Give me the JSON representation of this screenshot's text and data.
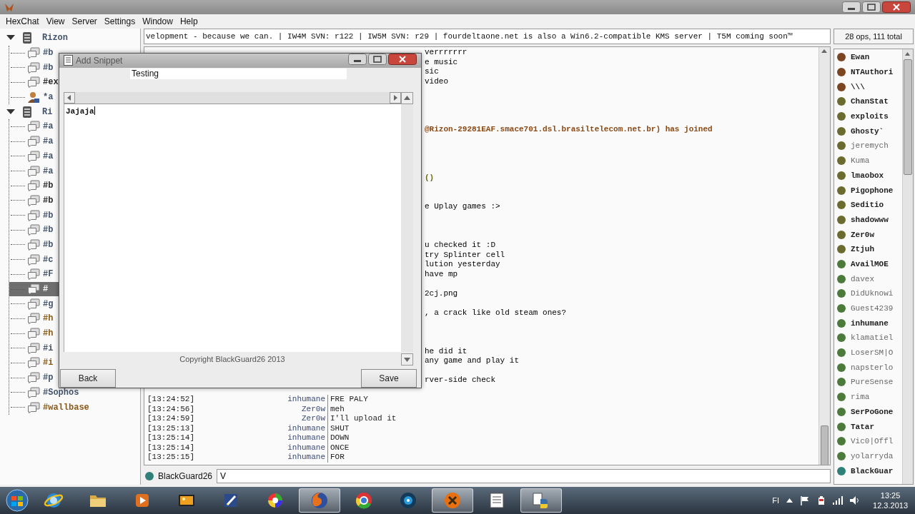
{
  "menu": [
    "HexChat",
    "View",
    "Server",
    "Settings",
    "Window",
    "Help"
  ],
  "tree": [
    {
      "label": "Rizon",
      "kind": "network",
      "expanded": true,
      "selected": false,
      "color": "#44546a",
      "children": [
        {
          "label": "#b",
          "kind": "channel",
          "selected": false,
          "color": "#44546a"
        },
        {
          "label": "#b",
          "kind": "channel",
          "selected": false,
          "color": "#44546a"
        },
        {
          "label": "#ex",
          "kind": "channel",
          "selected": false,
          "color": "#2b2b2b"
        },
        {
          "label": "*a",
          "kind": "query",
          "selected": false,
          "color": "#44546a"
        }
      ]
    },
    {
      "label": "Ri",
      "kind": "network",
      "expanded": true,
      "selected": false,
      "color": "#44546a",
      "children": [
        {
          "label": "#a",
          "kind": "channel",
          "selected": false,
          "color": "#44546a"
        },
        {
          "label": "#a",
          "kind": "channel",
          "selected": false,
          "color": "#44546a"
        },
        {
          "label": "#a",
          "kind": "channel",
          "selected": false,
          "color": "#44546a"
        },
        {
          "label": "#a",
          "kind": "channel",
          "selected": false,
          "color": "#44546a"
        },
        {
          "label": "#b",
          "kind": "channel",
          "selected": false,
          "color": "#2b2b2b"
        },
        {
          "label": "#b",
          "kind": "channel",
          "selected": false,
          "color": "#2b2b2b"
        },
        {
          "label": "#b",
          "kind": "channel",
          "selected": false,
          "color": "#44546a"
        },
        {
          "label": "#b",
          "kind": "channel",
          "selected": false,
          "color": "#44546a"
        },
        {
          "label": "#b",
          "kind": "channel",
          "selected": false,
          "color": "#44546a"
        },
        {
          "label": "#c",
          "kind": "channel",
          "selected": false,
          "color": "#44546a"
        },
        {
          "label": "#F",
          "kind": "channel",
          "selected": false,
          "color": "#44546a"
        },
        {
          "label": "#",
          "kind": "channel",
          "selected": true
        },
        {
          "label": "#g",
          "kind": "channel",
          "selected": false,
          "color": "#44546a"
        },
        {
          "label": "#h",
          "kind": "channel",
          "selected": false,
          "color": "#8a5a1a"
        },
        {
          "label": "#h",
          "kind": "channel",
          "selected": false,
          "color": "#8a5a1a"
        },
        {
          "label": "#i",
          "kind": "channel",
          "selected": false,
          "color": "#44546a"
        },
        {
          "label": "#i",
          "kind": "channel",
          "selected": false,
          "color": "#8a5a1a"
        },
        {
          "label": "#p",
          "kind": "channel",
          "selected": false,
          "color": "#44546a"
        },
        {
          "label": "#Sophos",
          "kind": "channel",
          "selected": false,
          "color": "#44546a"
        },
        {
          "label": "#wallbase",
          "kind": "channel",
          "selected": false,
          "color": "#8a5a1a"
        }
      ]
    }
  ],
  "topic": "velopment - because we can. | IW4M SVN: r122 | IW5M SVN: r29 | fourdeltaone.net is also a Win6.2-compatible KMS server | T5M coming soon™",
  "user_count": "28 ops, 111 total",
  "chat_lines": [
    {
      "kind": "fragment",
      "text": "verrrrrrr"
    },
    {
      "kind": "fragment",
      "text": "e music"
    },
    {
      "kind": "fragment",
      "text": "sic"
    },
    {
      "kind": "fragment",
      "text": "video"
    },
    {
      "kind": "fragment",
      "text": "@Rizon-29281EAF.smace701.dsl.brasiltelecom.net.br) has joined",
      "color": "#8b4a14"
    },
    {
      "kind": "fragment",
      "text": "()",
      "color": "#6b6b1f"
    },
    {
      "kind": "fragment",
      "text": "e Uplay games :>"
    },
    {
      "kind": "fragment",
      "text": "u checked it :D"
    },
    {
      "kind": "fragment",
      "text": "try Splinter cell"
    },
    {
      "kind": "fragment",
      "text": "lution yesterday"
    },
    {
      "kind": "fragment",
      "text": "have mp"
    },
    {
      "kind": "fragment",
      "text": "2cj.png"
    },
    {
      "kind": "fragment",
      "text": ", a crack like old steam ones?"
    },
    {
      "kind": "fragment",
      "text": "he did it"
    },
    {
      "kind": "fragment",
      "text": "any game and play it"
    },
    {
      "kind": "fragment",
      "text": "rver-side check"
    },
    {
      "kind": "message",
      "time": "[13:24:52]",
      "nick": "inhumane",
      "text": "FRE PALY"
    },
    {
      "kind": "message",
      "time": "[13:24:56]",
      "nick": "Zer0w",
      "text": "meh"
    },
    {
      "kind": "message",
      "time": "[13:24:59]",
      "nick": "Zer0w",
      "text": "I'll upload it"
    },
    {
      "kind": "message",
      "time": "[13:25:13]",
      "nick": "inhumane",
      "text": "SHUT"
    },
    {
      "kind": "message",
      "time": "[13:25:14]",
      "nick": "inhumane",
      "text": "DOWN"
    },
    {
      "kind": "message",
      "time": "[13:25:14]",
      "nick": "inhumane",
      "text": "ONCE"
    },
    {
      "kind": "message",
      "time": "[13:25:15]",
      "nick": "inhumane",
      "text": "FOR"
    }
  ],
  "users": [
    {
      "name": "Ewan",
      "color": "#7a4520",
      "away": false
    },
    {
      "name": "NTAuthori",
      "color": "#7a4520",
      "away": false
    },
    {
      "name": "\\\\\\",
      "color": "#7a4520",
      "away": false
    },
    {
      "name": "ChanStat",
      "color": "#6b6b2f",
      "away": false
    },
    {
      "name": "exploits",
      "color": "#6b6b2f",
      "away": false
    },
    {
      "name": "Ghosty`",
      "color": "#6b6b2f",
      "away": false
    },
    {
      "name": "jeremych",
      "color": "#6b6b2f",
      "away": true
    },
    {
      "name": "Kuma",
      "color": "#6b6b2f",
      "away": true
    },
    {
      "name": "lmaobox",
      "color": "#6b6b2f",
      "away": false
    },
    {
      "name": "Pigophone",
      "color": "#6b6b2f",
      "away": false
    },
    {
      "name": "Seditio",
      "color": "#6b6b2f",
      "away": false
    },
    {
      "name": "shadowww",
      "color": "#6b6b2f",
      "away": false
    },
    {
      "name": "Zer0w",
      "color": "#6b6b2f",
      "away": false
    },
    {
      "name": "Ztjuh",
      "color": "#6b6b2f",
      "away": false
    },
    {
      "name": "AvailMOE",
      "color": "#4b7a3a",
      "away": false
    },
    {
      "name": "davex",
      "color": "#4b7a3a",
      "away": true
    },
    {
      "name": "DidUknowi",
      "color": "#4b7a3a",
      "away": true
    },
    {
      "name": "Guest4239",
      "color": "#4b7a3a",
      "away": true
    },
    {
      "name": "inhumane",
      "color": "#4b7a3a",
      "away": false
    },
    {
      "name": "klamatiel",
      "color": "#4b7a3a",
      "away": true
    },
    {
      "name": "LoserSM|O",
      "color": "#4b7a3a",
      "away": true
    },
    {
      "name": "napsterlo",
      "color": "#4b7a3a",
      "away": true
    },
    {
      "name": "PureSense",
      "color": "#4b7a3a",
      "away": true
    },
    {
      "name": "rima",
      "color": "#4b7a3a",
      "away": true
    },
    {
      "name": "SerPoGone",
      "color": "#4b7a3a",
      "away": false
    },
    {
      "name": "Tatar",
      "color": "#4b7a3a",
      "away": false
    },
    {
      "name": "Vic0|Offl",
      "color": "#4b7a3a",
      "away": true
    },
    {
      "name": "yolarryda",
      "color": "#4b7a3a",
      "away": true
    },
    {
      "name": "BlackGuar",
      "color": "#2e8078",
      "away": false
    }
  ],
  "input": {
    "nick": "BlackGuard26",
    "value": "V",
    "color": "#2e8078"
  },
  "dialog": {
    "title": "Add Snippet",
    "name_value": "Testing",
    "body_value": "Jajaja",
    "copyright": "Copyright BlackGuard26 2013",
    "buttons": [
      {
        "label": "Back"
      },
      {
        "label": "Save"
      }
    ]
  },
  "taskbar": {
    "apps": [
      {
        "kind": "ie",
        "active": false
      },
      {
        "kind": "folder",
        "active": false
      },
      {
        "kind": "media",
        "active": false
      },
      {
        "kind": "picture",
        "active": false
      },
      {
        "kind": "pen",
        "active": false
      },
      {
        "kind": "palette",
        "active": false
      },
      {
        "kind": "firefox",
        "active": true
      },
      {
        "kind": "chrome",
        "active": false
      },
      {
        "kind": "disc",
        "active": false
      },
      {
        "kind": "xapp",
        "active": true
      },
      {
        "kind": "document",
        "active": false
      },
      {
        "kind": "python",
        "active": true
      }
    ],
    "language": "FI",
    "time": "13:25",
    "date": "12.3.2013"
  }
}
